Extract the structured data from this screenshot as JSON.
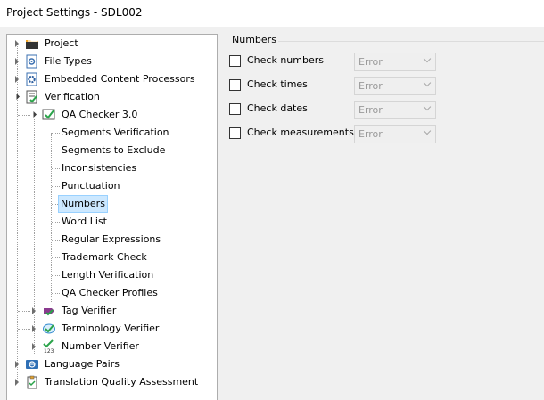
{
  "window": {
    "title": "Project Settings - SDL002"
  },
  "tree": {
    "project": "Project",
    "file_types": "File Types",
    "embedded": "Embedded Content Processors",
    "verification": "Verification",
    "qa_checker": "QA Checker 3.0",
    "qa_children": [
      "Segments Verification",
      "Segments to Exclude",
      "Inconsistencies",
      "Punctuation",
      "Numbers",
      "Word List",
      "Regular Expressions",
      "Trademark Check",
      "Length Verification",
      "QA Checker Profiles"
    ],
    "tag_verifier": "Tag Verifier",
    "terminology_verifier": "Terminology Verifier",
    "number_verifier": "Number Verifier",
    "language_pairs": "Language Pairs",
    "tqa": "Translation Quality Assessment"
  },
  "panel": {
    "group_title": "Numbers",
    "checks": [
      {
        "label": "Check numbers",
        "value": "Error",
        "checked": false
      },
      {
        "label": "Check times",
        "value": "Error",
        "checked": false
      },
      {
        "label": "Check dates",
        "value": "Error",
        "checked": false
      },
      {
        "label": "Check measurements",
        "value": "Error",
        "checked": false
      }
    ]
  }
}
